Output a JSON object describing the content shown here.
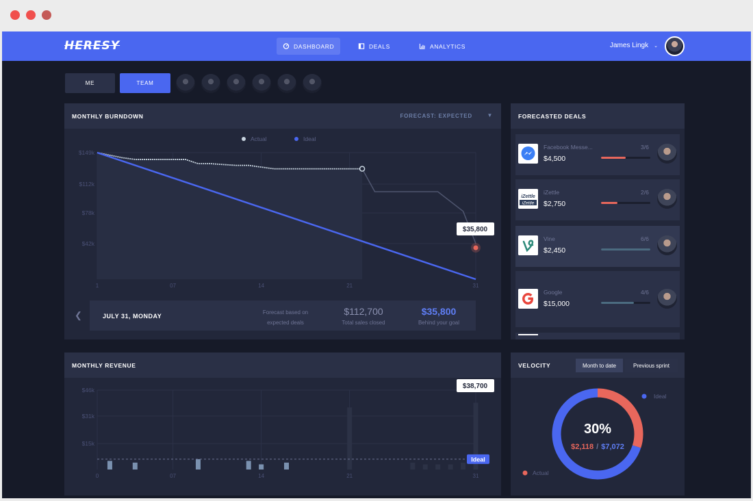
{
  "header": {
    "logo": "HERESY",
    "nav": [
      {
        "label": "DASHBOARD",
        "icon": "dashboard-icon",
        "active": true
      },
      {
        "label": "DEALS",
        "icon": "deals-icon",
        "active": false
      },
      {
        "label": "ANALYTICS",
        "icon": "analytics-icon",
        "active": false
      }
    ],
    "user_name": "James Lingk",
    "user_caret": "⌄"
  },
  "filters": {
    "me": "ME",
    "team": "TEAM"
  },
  "burndown": {
    "title": "MONTHLY BURNDOWN",
    "forecast_label": "FORECAST: EXPECTED",
    "forecast_caret": "▼",
    "legend": {
      "actual": "Actual",
      "ideal": "Ideal"
    },
    "callout": "$35,800",
    "summary": {
      "date": "JULY 31, MONDAY",
      "note": "Forecast based on expected deals",
      "closed_value": "$112,700",
      "closed_label": "Total sales closed",
      "behind_value": "$35,800",
      "behind_label": "Behind your goal",
      "prev_icon": "chevron-left-icon"
    }
  },
  "chart_data": [
    {
      "type": "line",
      "title": "MONTHLY BURNDOWN",
      "xlim": [
        1,
        31
      ],
      "ylim": [
        0,
        149
      ],
      "y_ticks": [
        "$149k",
        "$112k",
        "$78k",
        "$42k"
      ],
      "y_tick_values": [
        149,
        112,
        78,
        42
      ],
      "x_ticks": [
        "1",
        "07",
        "14",
        "21",
        "31"
      ],
      "x_tick_values": [
        1,
        7,
        14,
        21,
        31
      ],
      "series": [
        {
          "name": "Actual",
          "x": [
            1,
            3,
            4,
            8,
            9,
            10,
            12,
            13,
            15,
            16,
            22
          ],
          "y": [
            149,
            143,
            141,
            141,
            136,
            136,
            134,
            134,
            130,
            130,
            130
          ]
        },
        {
          "name": "Forecast",
          "x": [
            22,
            23,
            28,
            30,
            31
          ],
          "y": [
            130,
            103,
            103,
            80,
            42
          ]
        },
        {
          "name": "Ideal",
          "x": [
            1,
            31
          ],
          "y": [
            149,
            0
          ]
        }
      ],
      "grid": true,
      "legend": "top"
    },
    {
      "type": "bar",
      "title": "MONTHLY REVENUE",
      "xlim": [
        1,
        31
      ],
      "ylim": [
        0,
        46
      ],
      "y_ticks": [
        "$46k",
        "$31k",
        "$15k"
      ],
      "y_tick_values": [
        46,
        31,
        15
      ],
      "x_ticks": [
        "0",
        "07",
        "14",
        "21",
        "31"
      ],
      "x_tick_values": [
        1,
        7,
        14,
        21,
        31
      ],
      "x": [
        2,
        4,
        9,
        13,
        14,
        16,
        21,
        26,
        27,
        28,
        29,
        30,
        31
      ],
      "values": [
        5,
        4,
        6,
        5,
        3,
        4,
        36,
        4,
        3,
        3,
        3,
        4,
        38.7
      ],
      "reference": {
        "name": "Ideal",
        "value": 6
      },
      "callout": "$38,700",
      "grid": true
    },
    {
      "type": "pie",
      "title": "VELOCITY",
      "labels": [
        "Ideal",
        "Actual"
      ],
      "values": [
        70,
        30
      ],
      "center_label": "30%"
    }
  ],
  "revenue": {
    "title": "MONTHLY REVENUE",
    "ideal_label": "Ideal",
    "callout": "$38,700"
  },
  "deals": {
    "title": "FORECASTED DEALS",
    "items": [
      {
        "name": "Facebook Messe...",
        "value": "$4,500",
        "progress": "3/6",
        "progress_fraction": 0.5,
        "bar_color": "#e8675c",
        "logo": "messenger-icon"
      },
      {
        "name": "iZettle",
        "value": "$2,750",
        "progress": "2/6",
        "progress_fraction": 0.33,
        "bar_color": "#e8675c",
        "logo": "izettle-logo"
      },
      {
        "name": "Vine",
        "value": "$2,450",
        "progress": "6/6",
        "progress_fraction": 1.0,
        "bar_color": "#4b6b80",
        "logo": "vine-icon"
      },
      {
        "name": "Google",
        "value": "$15,000",
        "progress": "4/6",
        "progress_fraction": 0.67,
        "bar_color": "#4b6b80",
        "logo": "google-icon"
      }
    ],
    "izettle_logo_text": "iZettle"
  },
  "velocity": {
    "title": "VELOCITY",
    "tabs": [
      "Month to date",
      "Previous sprint"
    ],
    "percent": "30%",
    "actual_amount": "$2,118",
    "separator": "/",
    "ideal_amount": "$7,072",
    "legend_ideal": "Ideal",
    "legend_actual": "Actual"
  },
  "colors": {
    "accent": "#4a67f0",
    "actual": "#e8675c",
    "panel": "#22273a",
    "background": "#161a28"
  }
}
